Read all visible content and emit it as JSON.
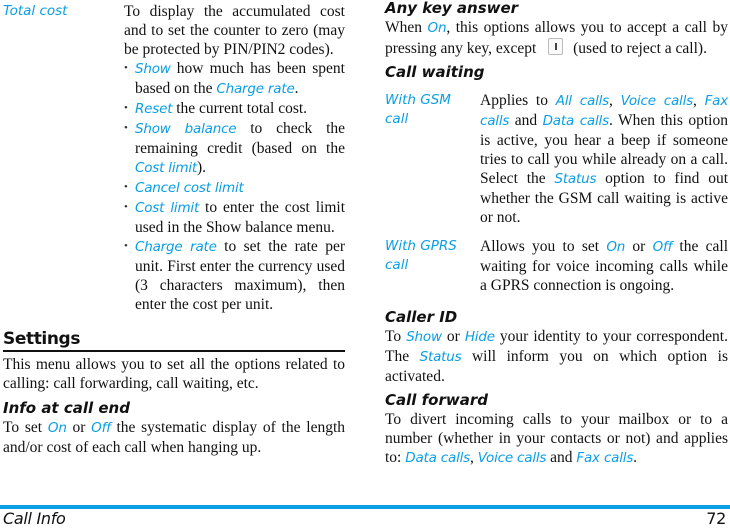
{
  "left_column": {
    "total_cost": {
      "term": "Total cost",
      "intro": "To display the accumulated cost and to set the counter to zero (may be protected by PIN/PIN2 codes).",
      "bullets": [
        {
          "kw": "Show",
          "text": " how much has been spent based on the ",
          "kw2": "Charge rate",
          "tail": "."
        },
        {
          "kw": "Reset",
          "text": " the current total cost."
        },
        {
          "kw": "Show balance",
          "text": " to check the remaining credit (based on the ",
          "kw2": "Cost limit",
          "tail": ")."
        },
        {
          "kw": "Cancel cost limit",
          "text": ""
        },
        {
          "kw": "Cost limit",
          "text": " to enter the cost limit used in the Show balance menu."
        },
        {
          "kw": "Charge rate",
          "text": " to set the rate per unit. First enter the currency used (3 characters maximum), then enter the cost per unit."
        }
      ]
    },
    "settings": {
      "title": "Settings",
      "intro": "This menu allows you to set all the options related to calling: call forwarding, call waiting, etc."
    },
    "info_at_call_end": {
      "title": "Info at call end",
      "pre": "To set ",
      "kw_on": "On",
      "mid": " or ",
      "kw_off": "Off",
      "post": " the systematic display of the length and/or cost of each call when hanging up."
    }
  },
  "right_column": {
    "any_key_answer": {
      "title": "Any key answer",
      "pre": "When ",
      "kw_on": "On",
      "mid": ", this options allows you to accept a call by pressing any key, except ",
      "icon": "end-call-key-icon",
      "post": " (used to reject a call)."
    },
    "call_waiting": {
      "title": "Call waiting",
      "gsm": {
        "term_line1": "With GSM",
        "term_line2": "call",
        "pre": "Applies to ",
        "kw1": "All calls",
        "sep1": ", ",
        "kw2": "Voice calls",
        "sep2": ", ",
        "kw3": "Fax calls",
        "sep3": " and ",
        "kw4": "Data calls",
        "mid": ". When this option is active, you hear a beep if someone tries to call you while already on a call. Select the ",
        "kw5": "Status",
        "post": " option to find out whether the GSM call waiting is active or not."
      },
      "gprs": {
        "term_line1": "With GPRS",
        "term_line2": "call",
        "pre": "Allows you to set ",
        "kw_on": "On",
        "mid": " or ",
        "kw_off": "Off",
        "post": " the call waiting for voice incoming calls while a GPRS connection is ongoing."
      }
    },
    "caller_id": {
      "title": "Caller ID",
      "pre": "To ",
      "kw_show": "Show",
      "mid": " or ",
      "kw_hide": "Hide",
      "mid2": " your identity to your correspondent. The ",
      "kw_status": "Status",
      "post": " will inform you on which option is activated."
    },
    "call_forward": {
      "title": "Call forward",
      "pre": "To divert incoming calls to your mailbox or to a number (whether in your contacts or not) and applies to: ",
      "kw1": "Data calls",
      "sep1": ", ",
      "kw2": "Voice calls",
      "sep2": " and ",
      "kw3": "Fax calls",
      "post": "."
    }
  },
  "footer": {
    "chapter": "Call Info",
    "page_number": "72"
  },
  "colors": {
    "accent": "#0a9ee4",
    "text": "#111111"
  }
}
